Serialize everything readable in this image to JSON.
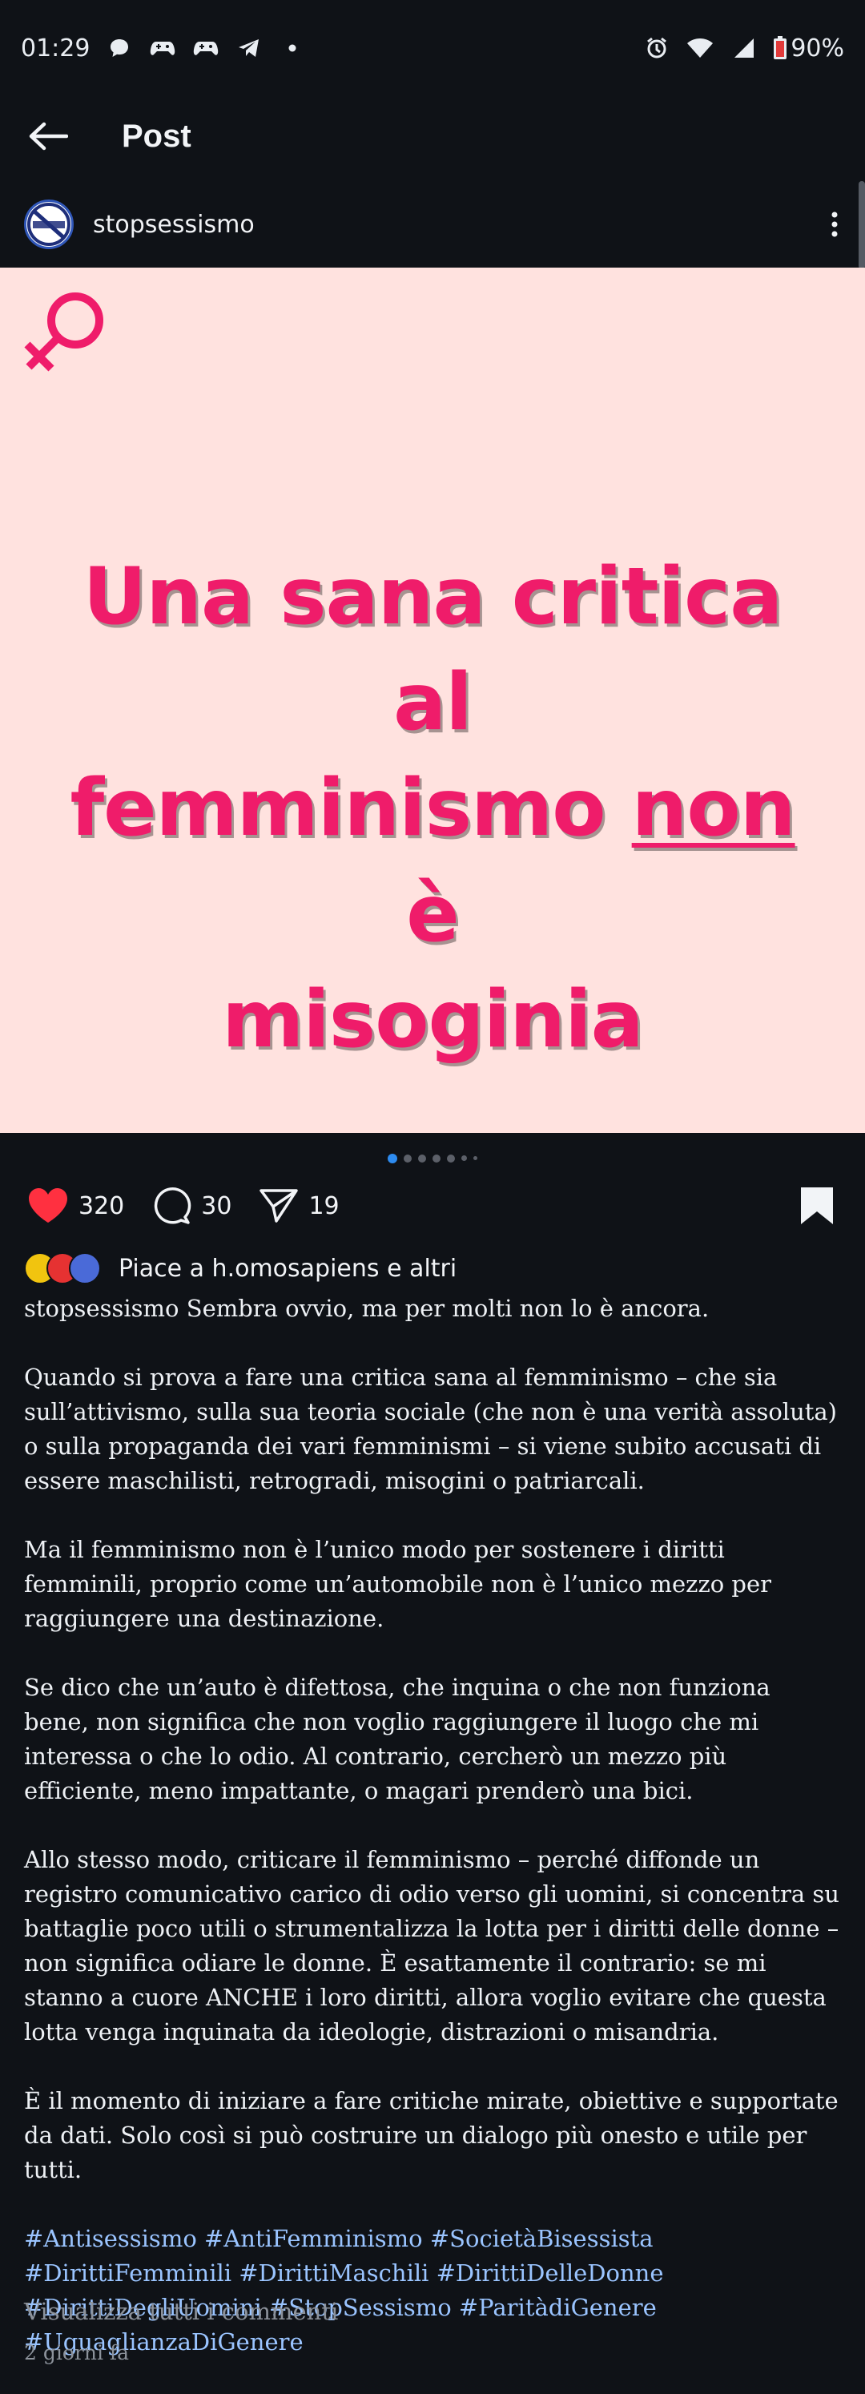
{
  "status_bar": {
    "time": "01:29",
    "battery": "90%",
    "left_icons": [
      "chat-bubble-icon",
      "game-controller-icon",
      "game-controller-icon",
      "telegram-icon",
      "dot-icon"
    ],
    "right_icons": [
      "alarm-icon",
      "wifi-icon",
      "signal-icon",
      "battery-icon"
    ]
  },
  "app_bar": {
    "title": "Post"
  },
  "profile": {
    "username": "stopsessismo"
  },
  "post_image": {
    "headline_line1": "Una sana critica al",
    "headline_line2_a": "femminismo ",
    "headline_line2_b": "non",
    "headline_line2_c": " è",
    "headline_line3": "misoginia",
    "accent_color": "#ef1c6a",
    "background_color": "#ffe2df"
  },
  "carousel": {
    "total": 7,
    "active_index": 0
  },
  "actions": {
    "likes": "320",
    "comments": "30",
    "shares": "19"
  },
  "liked_by": {
    "text": "Piace a h.omosapiens e altri"
  },
  "caption": {
    "username": "stopsessismo",
    "paragraphs": [
      "Sembra ovvio, ma per molti non lo è ancora.",
      "Quando si prova a fare una critica sana al femminismo – che sia sull’attivismo, sulla sua teoria sociale (che non è una verità assoluta) o sulla propaganda dei vari femminismi – si viene subito accusati di essere maschilisti, retrogradi, misogini o patriarcali.",
      "Ma il femminismo non è l’unico modo per sostenere i diritti femminili, proprio come un’automobile non è l’unico mezzo per raggiungere una destinazione.",
      "Se dico che un’auto è difettosa, che inquina o che non funziona bene, non significa che non voglio raggiungere il luogo che mi interessa o che lo odio. Al contrario, cercherò un mezzo più efficiente, meno impattante, o magari prenderò una bici.",
      "Allo stesso modo, criticare il femminismo – perché diffonde un registro comunicativo carico di odio verso gli uomini, si concentra su battaglie poco utili o strumentalizza la lotta per i diritti delle donne – non significa odiare le donne. È esattamente il contrario: se mi stanno a cuore ANCHE i loro diritti, allora voglio evitare che questa lotta venga inquinata da ideologie, distrazioni o misandria.",
      "È il momento di iniziare a fare critiche mirate, obiettive e supportate da dati. Solo così si può costruire un dialogo più onesto e utile per tutti."
    ],
    "hashtags": "#Antisessismo #AntiFemminismo #SocietàBisessista #DirittiFemminili #DirittiMaschili #DirittiDelleDonne #DirittiDegliUomini #StopSessismo #ParitàdiGenere #UguaglianzaDiGenere",
    "hashtag_color": "#9ac4ff"
  },
  "view_all_comments": "Visualizza tutti i commenti",
  "timestamp": "2 giorni fa"
}
